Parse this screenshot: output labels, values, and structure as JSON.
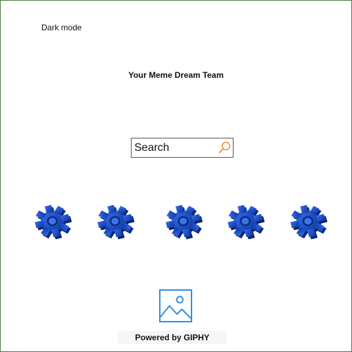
{
  "header": {
    "dark_mode_label": "Dark mode",
    "title": "Your Meme Dream Team"
  },
  "search": {
    "placeholder": "Search",
    "icon": "search-icon"
  },
  "gears": {
    "icon": "gear-icon",
    "count": 5,
    "color": "#1f4fc4"
  },
  "footer": {
    "image_icon": "image-placeholder-icon",
    "powered_by": "Powered by GIPHY"
  },
  "colors": {
    "frame_border": "#4f7a3a",
    "search_icon": "#e88a2a",
    "image_icon": "#2d8fe0"
  }
}
